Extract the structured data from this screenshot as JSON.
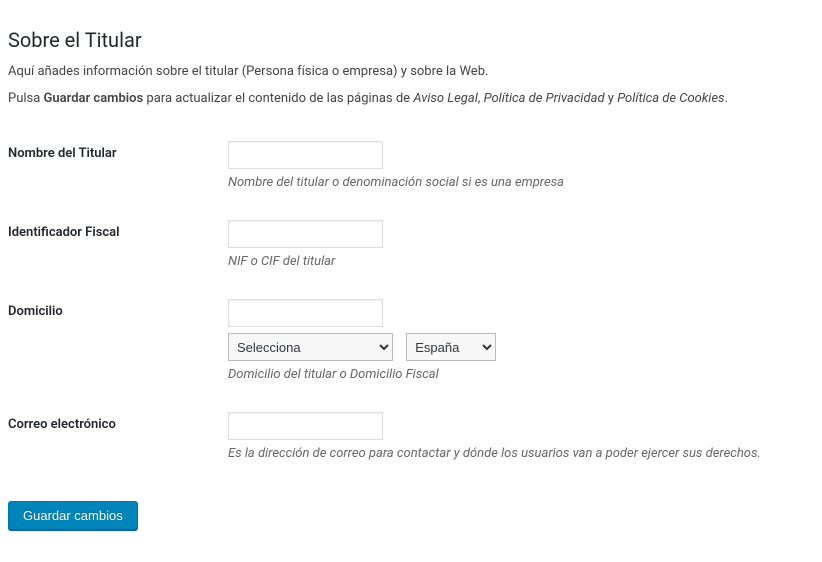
{
  "section": {
    "title": "Sobre el Titular",
    "intro1": "Aquí añades información sobre el titular (Persona física o empresa) y sobre la Web.",
    "intro2_a": "Pulsa ",
    "intro2_bold": "Guardar cambios",
    "intro2_b": " para actualizar el contenido de las páginas de ",
    "intro2_it1": "Aviso Legal",
    "intro2_sep1": ", ",
    "intro2_it2": "Política de Privacidad",
    "intro2_sep2": " y ",
    "intro2_it3": "Política de Cookies",
    "intro2_end": "."
  },
  "fields": {
    "nombre": {
      "label": "Nombre del Titular",
      "value": "",
      "desc": "Nombre del titular o denominación social si es una empresa"
    },
    "fiscal": {
      "label": "Identificador Fiscal",
      "value": "",
      "desc": "NIF o CIF del titular"
    },
    "domicilio": {
      "label": "Domicilio",
      "value": "",
      "province_selected": "Selecciona",
      "country_selected": "España",
      "desc": "Domicilio del titular o Domicilio Fiscal"
    },
    "correo": {
      "label": "Correo electrónico",
      "value": "",
      "desc": "Es la dirección de correo para contactar y dónde los usuarios van a poder ejercer sus derechos."
    }
  },
  "actions": {
    "save": "Guardar cambios"
  }
}
